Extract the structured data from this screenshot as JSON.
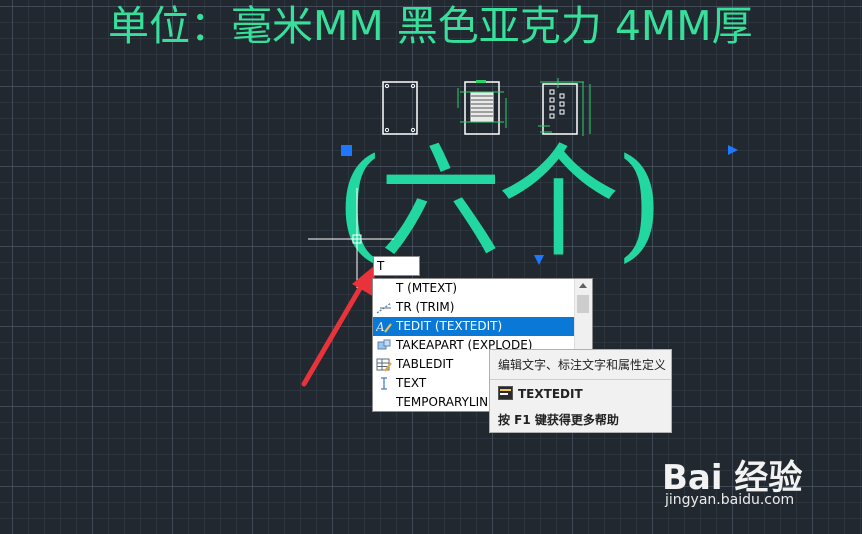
{
  "canvas": {
    "headline": "单位：毫米MM 黑色亚克力 4MM厚",
    "big_text": "(六个)"
  },
  "command_input": {
    "value": "T"
  },
  "autocomplete": {
    "items": [
      {
        "label": "T (MTEXT)",
        "icon": ""
      },
      {
        "label": "TR (TRIM)",
        "icon": "trim-icon"
      },
      {
        "label": "TEDIT (TEXTEDIT)",
        "icon": "text-edit-icon",
        "selected": true
      },
      {
        "label": "TAKEAPART (EXPLODE)",
        "icon": "explode-icon"
      },
      {
        "label": "TABLEDIT",
        "icon": "table-edit-icon"
      },
      {
        "label": "TEXT",
        "icon": "text-cursor-icon"
      },
      {
        "label": "TEMPORARYLINE",
        "icon": ""
      }
    ]
  },
  "tooltip": {
    "description": "编辑文字、标注文字和属性定义",
    "command": "TEXTEDIT",
    "help": "按 F1 键获得更多帮助"
  },
  "watermark": {
    "brand": "Bai 经验",
    "url": "jingyan.baidu.com"
  },
  "colors": {
    "background": "#212830",
    "headline": "#36e09a",
    "big_text": "#22d8a0",
    "arrow": "#e8333a",
    "selection": "#0a78d7",
    "grip": "#1e78ff"
  }
}
